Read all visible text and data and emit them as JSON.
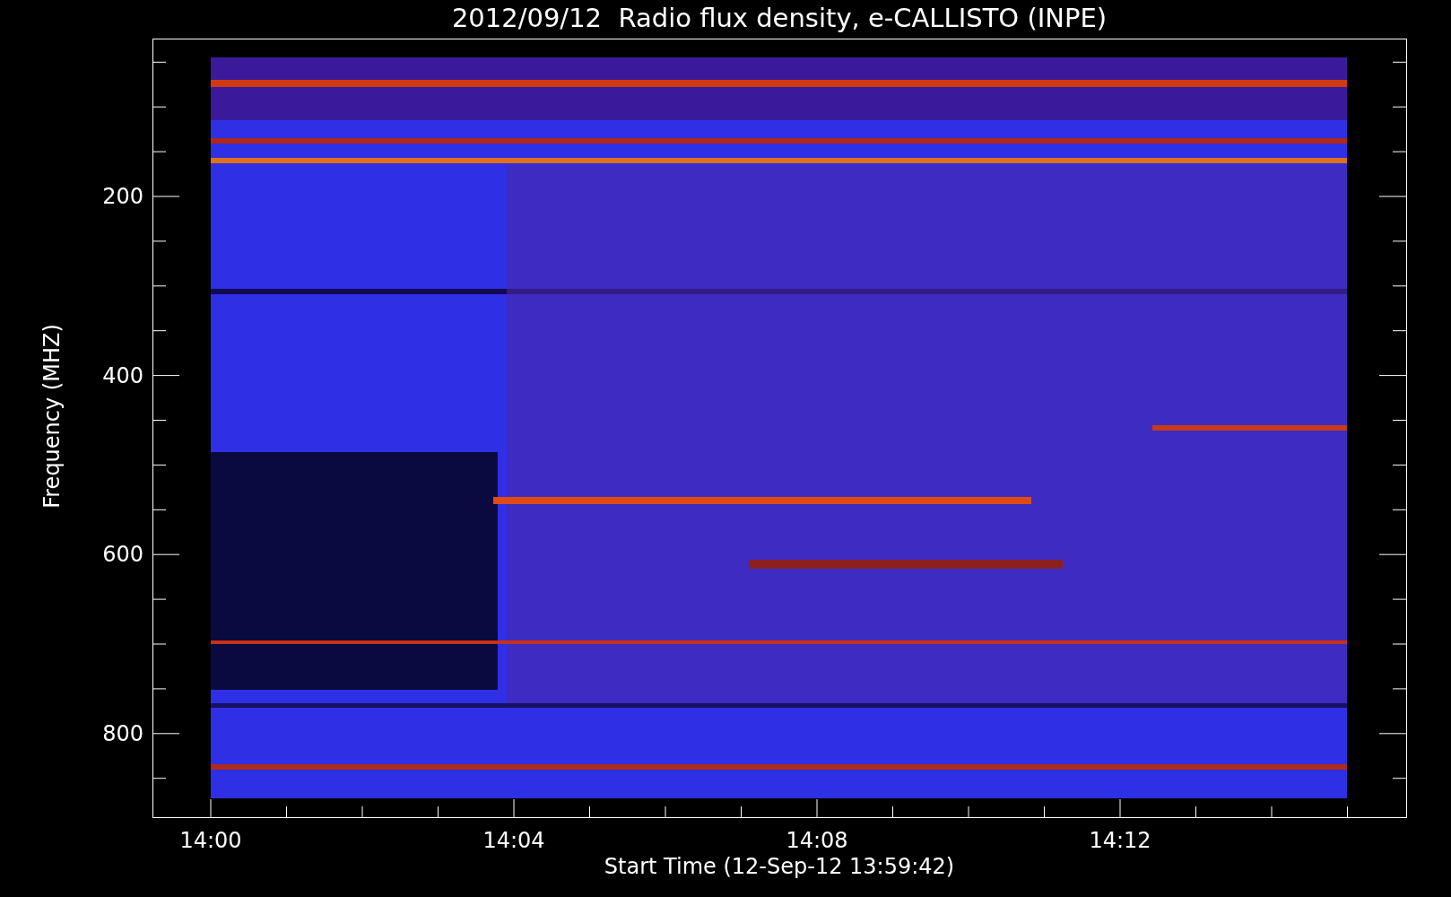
{
  "title": "2012/09/12  Radio flux density, e-CALLISTO (INPE)",
  "y_axis": {
    "label": "Frequency (MHZ)",
    "ticks": [
      "200",
      "400",
      "600",
      "800"
    ]
  },
  "x_axis": {
    "label": "Start Time (12-Sep-12 13:59:42)",
    "ticks": [
      "14:00",
      "14:04",
      "14:08",
      "14:12"
    ]
  }
}
